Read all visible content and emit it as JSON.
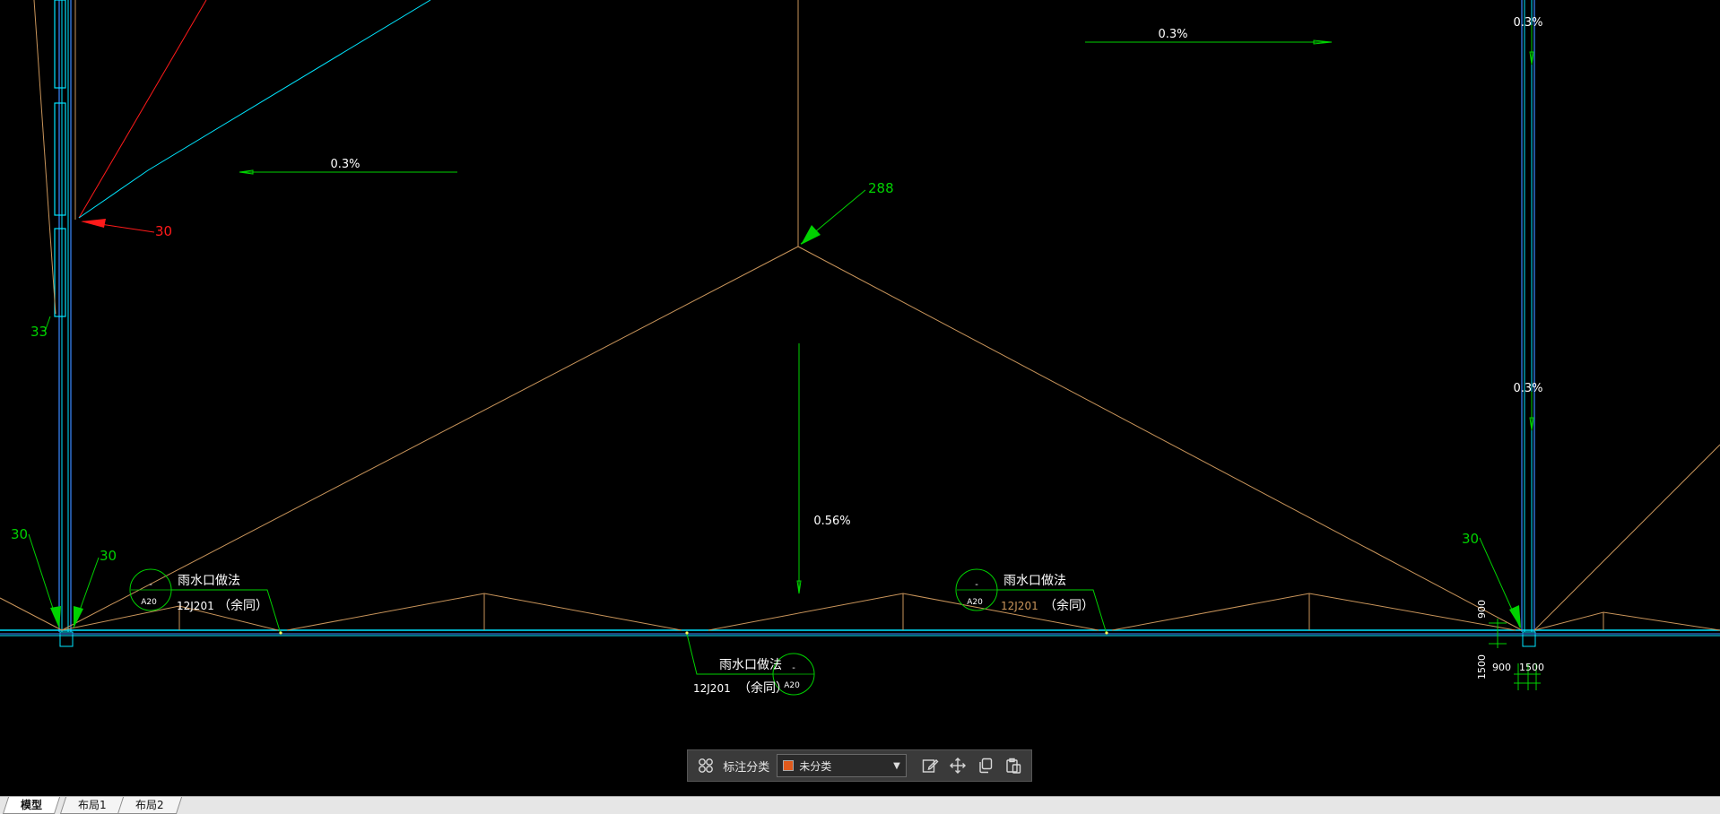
{
  "colors": {
    "background": "#000000",
    "slope": "#c8945a",
    "wall": "#2f6fd0",
    "window": "#00e6ff",
    "annotation": "#00d200",
    "red_dim": "#ff1a1a",
    "text": "#ffffff",
    "legend_swatch": "#e05a1c"
  },
  "drawing": {
    "slopes": {
      "top_right": "0.3%",
      "top_left": "0.3%",
      "right_upper": "0.3%",
      "right_middle": "0.3%",
      "center": "0.56%"
    },
    "dims": {
      "left_red": "30",
      "left_33": "33",
      "ridge_288": "288",
      "left_outer_30": "30",
      "left_inner_30": "30",
      "right_30": "30"
    },
    "drains": [
      {
        "code": "A20",
        "title": "雨水口做法",
        "ref": "12J201",
        "note": "（余同）"
      },
      {
        "code": "A20",
        "title": "雨水口做法",
        "ref": "12J201",
        "note": "（余同）"
      },
      {
        "code": "A20",
        "title": "雨水口做法",
        "ref": "12J201",
        "note": "（余同）"
      }
    ],
    "drain_dims": {
      "v900": "900",
      "v1500": "1500",
      "h900": "900",
      "h1500": "1500"
    }
  },
  "toolbar": {
    "label": "标注分类",
    "selected": "未分类",
    "icons": [
      "category-grid-icon",
      "edit-annotation-icon",
      "move-icon",
      "copy-icon",
      "paste-icon"
    ]
  },
  "tabs": [
    "模型",
    "布局1",
    "布局2"
  ]
}
